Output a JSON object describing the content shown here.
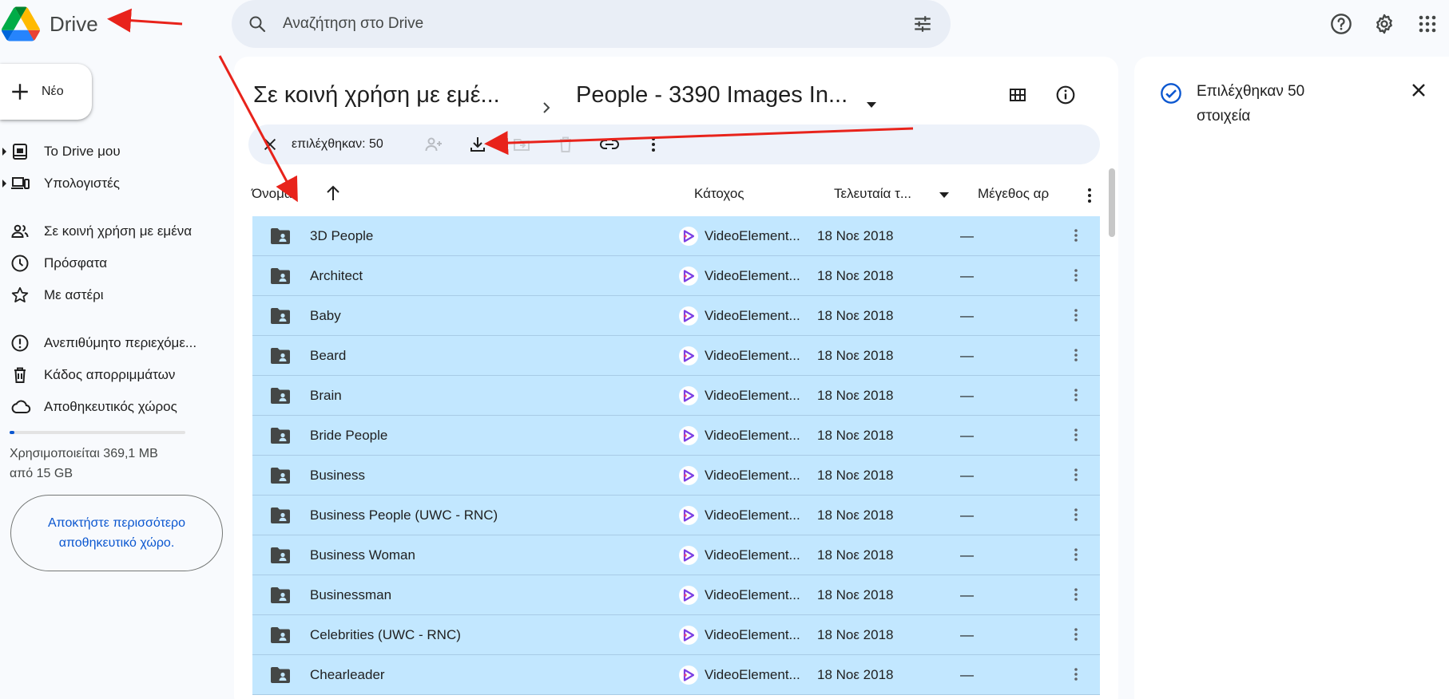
{
  "app": {
    "name": "Drive",
    "brand_colors": [
      "#0066da",
      "#00ac47",
      "#ea4335",
      "#00832d",
      "#2684fc",
      "#ffba00"
    ]
  },
  "search": {
    "placeholder": "Αναζήτηση στο Drive"
  },
  "header_icons": [
    "help-icon",
    "settings-icon",
    "apps-icon"
  ],
  "new_button": {
    "label": "Νέο"
  },
  "sidebar": {
    "items": [
      {
        "label": "Το Drive μου",
        "icon": "my-drive-icon"
      },
      {
        "label": "Υπολογιστές",
        "icon": "computers-icon"
      },
      {
        "label": "Σε κοινή χρήση με εμένα",
        "icon": "shared-icon"
      },
      {
        "label": "Πρόσφατα",
        "icon": "clock-icon"
      },
      {
        "label": "Με αστέρι",
        "icon": "star-icon"
      },
      {
        "label": "Ανεπιθύμητο περιεχόμε...",
        "icon": "spam-icon"
      },
      {
        "label": "Κάδος απορριμμάτων",
        "icon": "trash-icon"
      },
      {
        "label": "Αποθηκευτικός χώρος",
        "icon": "cloud-icon"
      }
    ],
    "storage": {
      "used_fraction": 0.025,
      "line1": "Χρησιμοποιείται 369,1 MB",
      "line2": "από 15 GB"
    },
    "get_storage": "Αποκτήστε περισσότερο αποθηκευτικό χώρο."
  },
  "breadcrumb": {
    "parent": "Σε κοινή χρήση με εμέ...",
    "current": "People - 3390 Images In..."
  },
  "selection_bar": {
    "count_label": "επιλέχθηκαν: 50",
    "actions": [
      "close-icon",
      "share-icon",
      "download-icon",
      "move-icon",
      "trash-icon",
      "link-icon",
      "more-icon"
    ]
  },
  "columns": {
    "name": "Όνομα",
    "owner": "Κάτοχος",
    "modified": "Τελευταία τ...",
    "size": "Μέγεθος αρ"
  },
  "files": [
    {
      "name": "3D People",
      "owner": "VideoElement...",
      "modified": "18 Νοε 2018",
      "size": "—"
    },
    {
      "name": "Architect",
      "owner": "VideoElement...",
      "modified": "18 Νοε 2018",
      "size": "—"
    },
    {
      "name": "Baby",
      "owner": "VideoElement...",
      "modified": "18 Νοε 2018",
      "size": "—"
    },
    {
      "name": "Beard",
      "owner": "VideoElement...",
      "modified": "18 Νοε 2018",
      "size": "—"
    },
    {
      "name": "Brain",
      "owner": "VideoElement...",
      "modified": "18 Νοε 2018",
      "size": "—"
    },
    {
      "name": "Bride People",
      "owner": "VideoElement...",
      "modified": "18 Νοε 2018",
      "size": "—"
    },
    {
      "name": "Business",
      "owner": "VideoElement...",
      "modified": "18 Νοε 2018",
      "size": "—"
    },
    {
      "name": "Business People (UWC - RNC)",
      "owner": "VideoElement...",
      "modified": "18 Νοε 2018",
      "size": "—"
    },
    {
      "name": "Business Woman",
      "owner": "VideoElement...",
      "modified": "18 Νοε 2018",
      "size": "—"
    },
    {
      "name": "Businessman",
      "owner": "VideoElement...",
      "modified": "18 Νοε 2018",
      "size": "—"
    },
    {
      "name": "Celebrities (UWC - RNC)",
      "owner": "VideoElement...",
      "modified": "18 Νοε 2018",
      "size": "—"
    },
    {
      "name": "Chearleader",
      "owner": "VideoElement...",
      "modified": "18 Νοε 2018",
      "size": "—"
    }
  ],
  "details": {
    "title": "Επιλέχθηκαν 50 στοιχεία"
  },
  "colors": {
    "selected_row": "#c2e7ff",
    "accent": "#0b57d0",
    "annotation_arrow": "#e8231b"
  }
}
